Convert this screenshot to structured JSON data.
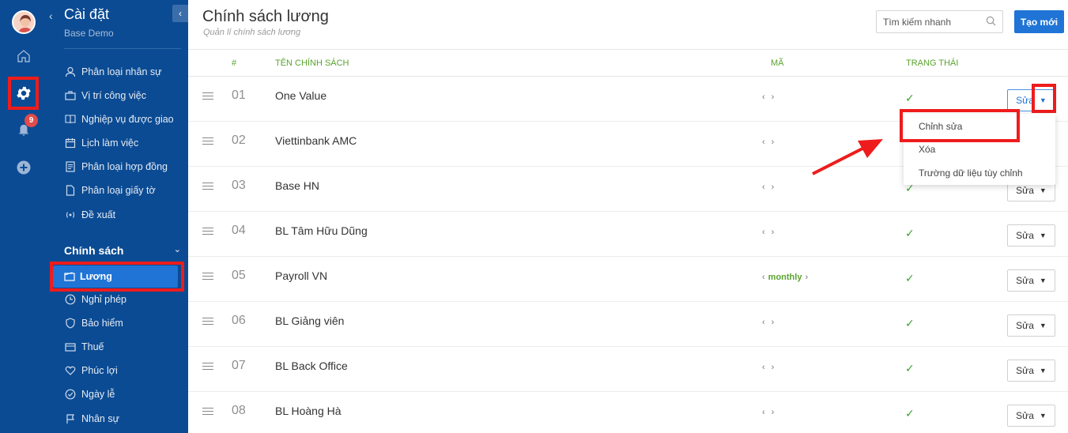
{
  "sidebar": {
    "title": "Cài đặt",
    "subtitle": "Base Demo",
    "items": [
      {
        "label": "Phân loại nhân sự",
        "icon": "user-icon"
      },
      {
        "label": "Vị trí công việc",
        "icon": "briefcase-icon"
      },
      {
        "label": "Nghiệp vụ được giao",
        "icon": "book-icon"
      },
      {
        "label": "Lịch làm việc",
        "icon": "calendar-icon"
      },
      {
        "label": "Phân loại hợp đồng",
        "icon": "contract-icon"
      },
      {
        "label": "Phân loại giấy tờ",
        "icon": "document-icon"
      },
      {
        "label": "Đề xuất",
        "icon": "broadcast-icon"
      }
    ],
    "section": "Chính sách",
    "active": "Lương",
    "policy_items": [
      {
        "label": "Nghỉ phép",
        "icon": "clock-icon"
      },
      {
        "label": "Bảo hiểm",
        "icon": "shield-icon"
      },
      {
        "label": "Thuế",
        "icon": "tax-icon"
      },
      {
        "label": "Phúc lợi",
        "icon": "heart-icon"
      },
      {
        "label": "Ngày lễ",
        "icon": "check-circle-icon"
      },
      {
        "label": "Nhân sự",
        "icon": "flag-icon"
      }
    ]
  },
  "rail": {
    "notification_count": "9"
  },
  "header": {
    "title": "Chính sách lương",
    "subtitle": "Quản lí chính sách lương",
    "search_placeholder": "Tìm kiếm nhanh",
    "create_label": "Tạo mới"
  },
  "table": {
    "columns": [
      "#",
      "TÊN CHÍNH SÁCH",
      "MÃ",
      "TRẠNG THÁI"
    ],
    "edit_label": "Sửa",
    "rows": [
      {
        "num": "01",
        "name": "One Value",
        "code": "",
        "status": "✓"
      },
      {
        "num": "02",
        "name": "Viettinbank AMC",
        "code": "",
        "status": "✓"
      },
      {
        "num": "03",
        "name": "Base HN",
        "code": "",
        "status": "✓"
      },
      {
        "num": "04",
        "name": "BL Tâm Hữu Dũng",
        "code": "",
        "status": "✓"
      },
      {
        "num": "05",
        "name": "Payroll VN",
        "code": "monthly",
        "status": "✓"
      },
      {
        "num": "06",
        "name": "BL Giảng viên",
        "code": "",
        "status": "✓"
      },
      {
        "num": "07",
        "name": "BL Back Office",
        "code": "",
        "status": "✓"
      },
      {
        "num": "08",
        "name": "BL Hoàng Hà",
        "code": "",
        "status": "✓"
      }
    ]
  },
  "dropdown": {
    "items": [
      "Chỉnh sửa",
      "Xóa",
      "Trường dữ liệu tùy chỉnh"
    ]
  },
  "colors": {
    "sidebar": "#0b4b93",
    "accent": "#1f74d6",
    "highlight": "#ee1c1c",
    "green": "#5aa32f"
  }
}
